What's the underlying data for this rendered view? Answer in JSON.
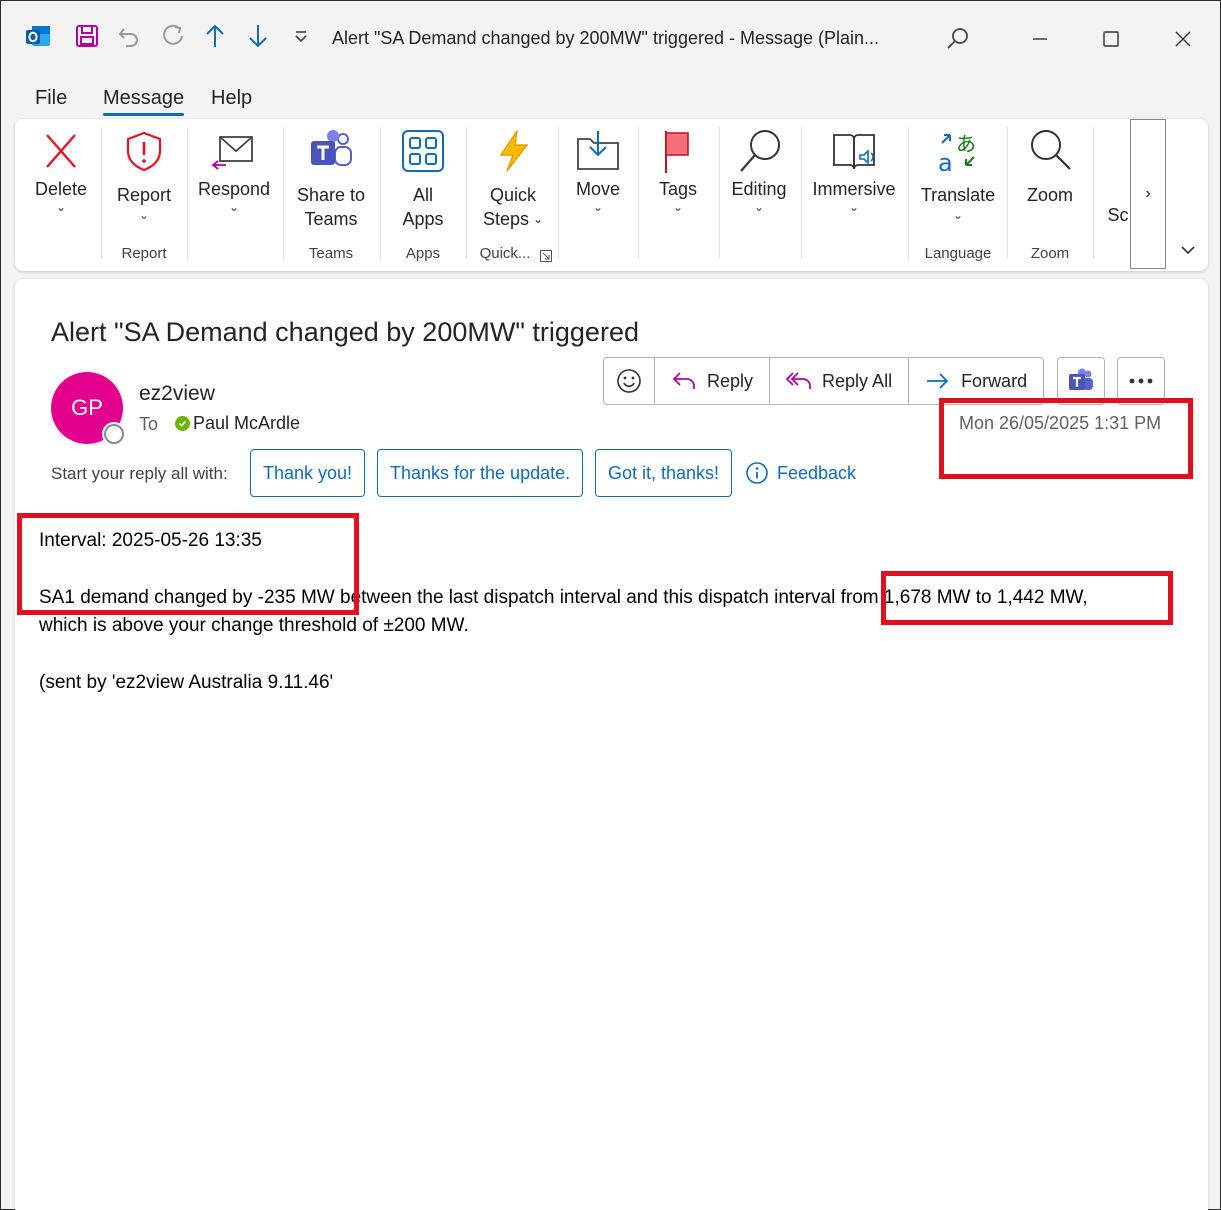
{
  "window": {
    "title": "Alert \"SA Demand changed by 200MW\" triggered  -  Message (Plain..."
  },
  "menu": {
    "tabs": [
      "File",
      "Message",
      "Help"
    ],
    "active": "Message"
  },
  "ribbon": {
    "buttons": {
      "delete": "Delete",
      "report": "Report",
      "respond": "Respond",
      "share_line1": "Share to",
      "share_line2": "Teams",
      "allapps_line1": "All",
      "allapps_line2": "Apps",
      "quick_line1": "Quick",
      "quick_line2": "Steps",
      "move": "Move",
      "tags": "Tags",
      "editing": "Editing",
      "immersive": "Immersive",
      "translate": "Translate",
      "zoom": "Zoom",
      "truncated": "Sc"
    },
    "groups": {
      "report": "Report",
      "teams": "Teams",
      "apps": "Apps",
      "quick": "Quick...",
      "language": "Language",
      "zoom": "Zoom"
    }
  },
  "message": {
    "subject": "Alert \"SA Demand changed by 200MW\" triggered",
    "avatar_initials": "GP",
    "sender": "ez2view",
    "to_label": "To",
    "recipient": "Paul McArdle",
    "date": "Mon 26/05/2025 1:31 PM",
    "actions": {
      "reply": "Reply",
      "reply_all": "Reply All",
      "forward": "Forward"
    },
    "quick_reply_label": "Start your reply all with:",
    "quick_replies": [
      "Thank you!",
      "Thanks for the update.",
      "Got it, thanks!"
    ],
    "feedback": "Feedback",
    "body": {
      "line1": "Interval: 2025-05-26 13:35",
      "line2": "SA1 demand changed by -235 MW between the last dispatch interval and this dispatch interval from 1,678 MW to 1,442 MW,",
      "line3": "which is above your change threshold of ±200 MW.",
      "line4": "(sent by 'ez2view Australia 9.11.46'"
    }
  },
  "colors": {
    "accent": "#0f6cbd",
    "avatar": "#e3008c",
    "annotation": "#e0101e",
    "presence_available": "#6bb700"
  }
}
